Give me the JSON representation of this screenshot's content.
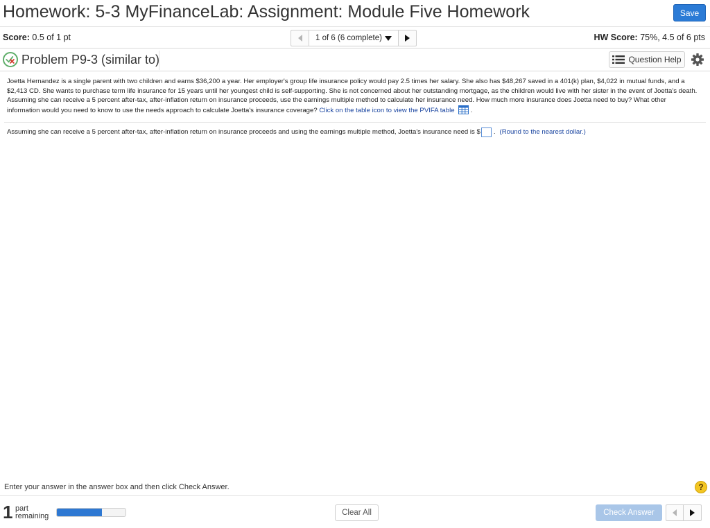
{
  "header": {
    "title": "Homework: 5-3 MyFinanceLab: Assignment: Module Five Homework",
    "save_label": "Save"
  },
  "scorebar": {
    "score_label": "Score:",
    "score_value": "0.5 of 1 pt",
    "question_position": "1 of 6 (6 complete)",
    "hw_score_label": "HW Score:",
    "hw_score_value": "75%, 4.5 of 6 pts"
  },
  "problem": {
    "title": "Problem P9-3 (similar to)",
    "help_label": "Question Help",
    "status": "partially-correct"
  },
  "question": {
    "body": "Joetta Hernandez is a single parent with two children and earns $36,200 a year. Her employer's group life insurance policy would pay 2.5 times her salary. She also has $48,267 saved in a 401(k) plan, $4,022 in mutual funds, and a $2,413 CD. She wants to purchase term life insurance for 15 years until her youngest child is self-supporting. She is not concerned about her outstanding mortgage, as the children would live with her sister in the event of Joetta's death. Assuming she can receive a 5 percent after-tax, after-inflation return on insurance proceeds, use the earnings multiple method to calculate her insurance need. How much more insurance does Joetta need to buy? What other information would you need to know to use the needs approach to calculate Joetta's insurance coverage?",
    "table_link": "Click on the table icon to view the PVIFA table",
    "table_link_suffix": ".",
    "answer_prompt": "Assuming she can receive a 5 percent after-tax, after-inflation return on insurance proceeds and using the earnings multiple method, Joetta's insurance need is $",
    "answer_value": "",
    "answer_suffix": ".",
    "round_note": "(Round to the nearest dollar.)"
  },
  "footer": {
    "instructions": "Enter your answer in the answer box and then click Check Answer.",
    "help_symbol": "?",
    "parts_count": "1",
    "parts_label_line1": "part",
    "parts_label_line2": "remaining",
    "progress_fraction": 0.66,
    "clear_label": "Clear All",
    "check_label": "Check Answer"
  },
  "colors": {
    "accent": "#2b7bd6",
    "progress": "#2e78d2",
    "check_disabled": "#a9c6e8",
    "link": "#1a45a0",
    "help_circle": "#f3c623"
  }
}
